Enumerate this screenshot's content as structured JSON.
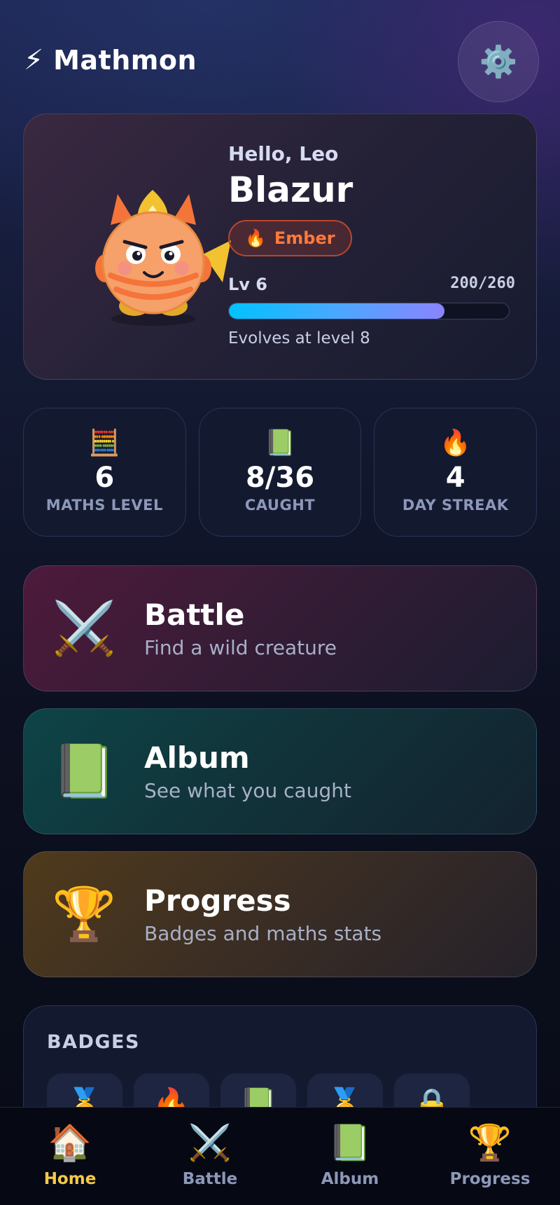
{
  "header": {
    "brand_icon": "⚡",
    "title": "Mathmon",
    "settings_icon": "⚙️"
  },
  "hero": {
    "greeting": "Hello, Leo",
    "creature_name": "Blazur",
    "type_icon": "🔥",
    "type_label": "Ember",
    "level_label": "Lv 6",
    "xp_text": "200/260",
    "xp_progress": 0.77,
    "evolve_note": "Evolves at level 8"
  },
  "stats": [
    {
      "icon": "🧮",
      "value": "6",
      "label": "MATHS LEVEL"
    },
    {
      "icon": "📗",
      "value": "8/36",
      "label": "CAUGHT"
    },
    {
      "icon": "🔥",
      "value": "4",
      "label": "DAY STREAK"
    }
  ],
  "actions": {
    "battle": {
      "icon": "⚔️",
      "title": "Battle",
      "subtitle": "Find a wild creature"
    },
    "album": {
      "icon": "📗",
      "title": "Album",
      "subtitle": "See what you caught"
    },
    "progress": {
      "icon": "🏆",
      "title": "Progress",
      "subtitle": "Badges and maths stats"
    }
  },
  "badges": {
    "title": "BADGES",
    "items": [
      "🥇",
      "🔥",
      "📗",
      "🥇",
      "🔒"
    ]
  },
  "nav": [
    {
      "icon": "🏠",
      "label": "Home",
      "active": true
    },
    {
      "icon": "⚔️",
      "label": "Battle",
      "active": false
    },
    {
      "icon": "📗",
      "label": "Album",
      "active": false
    },
    {
      "icon": "🏆",
      "label": "Progress",
      "active": false
    }
  ],
  "colors": {
    "accent_active": "#f7c948",
    "ember": "#ff7a3c",
    "xp_start": "#00c2ff",
    "xp_end": "#8b84ff"
  }
}
